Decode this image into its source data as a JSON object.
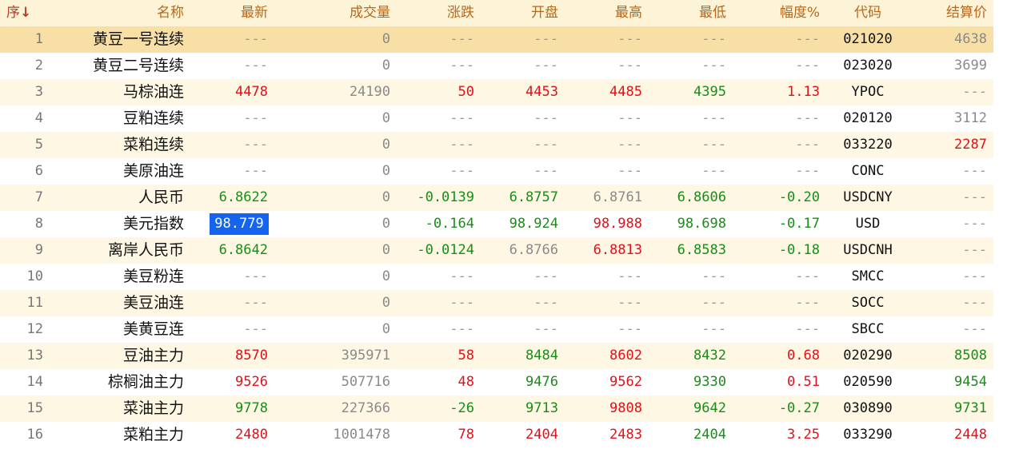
{
  "header": {
    "seq": "序",
    "sort_arrow": "↓",
    "name": "名称",
    "last": "最新",
    "volume": "成交量",
    "change": "涨跌",
    "open": "开盘",
    "high": "最高",
    "low": "最低",
    "pct": "幅度%",
    "code": "代码",
    "settle": "结算价"
  },
  "colors": {
    "up": "#e0121b",
    "down": "#1a8c1a",
    "neutral": "#8a8a8a",
    "header_text": "#b8681b",
    "selected_row": "#f8dfa6",
    "highlight_cell": "#1464f0"
  },
  "rows": [
    {
      "seq": "1",
      "name": "黄豆一号连续",
      "last": "---",
      "volume": "0",
      "change": "---",
      "open": "---",
      "high": "---",
      "low": "---",
      "pct": "---",
      "code": "021020",
      "settle": "4638"
    },
    {
      "seq": "2",
      "name": "黄豆二号连续",
      "last": "---",
      "volume": "0",
      "change": "---",
      "open": "---",
      "high": "---",
      "low": "---",
      "pct": "---",
      "code": "023020",
      "settle": "3699"
    },
    {
      "seq": "3",
      "name": "马棕油连",
      "last": "4478",
      "volume": "24190",
      "change": "50",
      "open": "4453",
      "high": "4485",
      "low": "4395",
      "pct": "1.13",
      "code": "YPOC",
      "settle": "---"
    },
    {
      "seq": "4",
      "name": "豆粕连续",
      "last": "---",
      "volume": "0",
      "change": "---",
      "open": "---",
      "high": "---",
      "low": "---",
      "pct": "---",
      "code": "020120",
      "settle": "3112"
    },
    {
      "seq": "5",
      "name": "菜粕连续",
      "last": "---",
      "volume": "0",
      "change": "---",
      "open": "---",
      "high": "---",
      "low": "---",
      "pct": "---",
      "code": "033220",
      "settle": "2287"
    },
    {
      "seq": "6",
      "name": "美原油连",
      "last": "---",
      "volume": "0",
      "change": "---",
      "open": "---",
      "high": "---",
      "low": "---",
      "pct": "---",
      "code": "CONC",
      "settle": "---"
    },
    {
      "seq": "7",
      "name": "人民币",
      "last": "6.8622",
      "volume": "0",
      "change": "-0.0139",
      "open": "6.8757",
      "high": "6.8761",
      "low": "6.8606",
      "pct": "-0.20",
      "code": "USDCNY",
      "settle": "---"
    },
    {
      "seq": "8",
      "name": "美元指数",
      "last": "98.779",
      "volume": "0",
      "change": "-0.164",
      "open": "98.924",
      "high": "98.988",
      "low": "98.698",
      "pct": "-0.17",
      "code": "USD",
      "settle": "---"
    },
    {
      "seq": "9",
      "name": "离岸人民币",
      "last": "6.8642",
      "volume": "0",
      "change": "-0.0124",
      "open": "6.8766",
      "high": "6.8813",
      "low": "6.8583",
      "pct": "-0.18",
      "code": "USDCNH",
      "settle": "---"
    },
    {
      "seq": "10",
      "name": "美豆粉连",
      "last": "---",
      "volume": "0",
      "change": "---",
      "open": "---",
      "high": "---",
      "low": "---",
      "pct": "---",
      "code": "SMCC",
      "settle": "---"
    },
    {
      "seq": "11",
      "name": "美豆油连",
      "last": "---",
      "volume": "0",
      "change": "---",
      "open": "---",
      "high": "---",
      "low": "---",
      "pct": "---",
      "code": "SOCC",
      "settle": "---"
    },
    {
      "seq": "12",
      "name": "美黄豆连",
      "last": "---",
      "volume": "0",
      "change": "---",
      "open": "---",
      "high": "---",
      "low": "---",
      "pct": "---",
      "code": "SBCC",
      "settle": "---"
    },
    {
      "seq": "13",
      "name": "豆油主力",
      "last": "8570",
      "volume": "395971",
      "change": "58",
      "open": "8484",
      "high": "8602",
      "low": "8432",
      "pct": "0.68",
      "code": "020290",
      "settle": "8508"
    },
    {
      "seq": "14",
      "name": "棕榈油主力",
      "last": "9526",
      "volume": "507716",
      "change": "48",
      "open": "9476",
      "high": "9562",
      "low": "9330",
      "pct": "0.51",
      "code": "020590",
      "settle": "9454"
    },
    {
      "seq": "15",
      "name": "菜油主力",
      "last": "9778",
      "volume": "227366",
      "change": "-26",
      "open": "9713",
      "high": "9808",
      "low": "9642",
      "pct": "-0.27",
      "code": "030890",
      "settle": "9731"
    },
    {
      "seq": "16",
      "name": "菜粕主力",
      "last": "2480",
      "volume": "1001478",
      "change": "78",
      "open": "2404",
      "high": "2483",
      "low": "2404",
      "pct": "3.25",
      "code": "033290",
      "settle": "2448"
    }
  ],
  "row_colors": [
    {
      "last": "dash",
      "volume": "gray",
      "change": "dash",
      "open": "dash",
      "high": "dash",
      "low": "dash",
      "pct": "dash",
      "settle": "gray"
    },
    {
      "last": "dash",
      "volume": "gray",
      "change": "dash",
      "open": "dash",
      "high": "dash",
      "low": "dash",
      "pct": "dash",
      "settle": "gray"
    },
    {
      "last": "red",
      "volume": "gray",
      "change": "red",
      "open": "red",
      "high": "red",
      "low": "green",
      "pct": "red",
      "settle": "dash"
    },
    {
      "last": "dash",
      "volume": "gray",
      "change": "dash",
      "open": "dash",
      "high": "dash",
      "low": "dash",
      "pct": "dash",
      "settle": "gray"
    },
    {
      "last": "dash",
      "volume": "gray",
      "change": "dash",
      "open": "dash",
      "high": "dash",
      "low": "dash",
      "pct": "dash",
      "settle": "red"
    },
    {
      "last": "dash",
      "volume": "gray",
      "change": "dash",
      "open": "dash",
      "high": "dash",
      "low": "dash",
      "pct": "dash",
      "settle": "dash"
    },
    {
      "last": "green",
      "volume": "gray",
      "change": "green",
      "open": "green",
      "high": "gray",
      "low": "green",
      "pct": "green",
      "settle": "dash"
    },
    {
      "last": "highlight",
      "volume": "gray",
      "change": "green",
      "open": "green",
      "high": "red",
      "low": "green",
      "pct": "green",
      "settle": "dash"
    },
    {
      "last": "green",
      "volume": "gray",
      "change": "green",
      "open": "gray",
      "high": "red",
      "low": "green",
      "pct": "green",
      "settle": "dash"
    },
    {
      "last": "dash",
      "volume": "gray",
      "change": "dash",
      "open": "dash",
      "high": "dash",
      "low": "dash",
      "pct": "dash",
      "settle": "dash"
    },
    {
      "last": "dash",
      "volume": "gray",
      "change": "dash",
      "open": "dash",
      "high": "dash",
      "low": "dash",
      "pct": "dash",
      "settle": "dash"
    },
    {
      "last": "dash",
      "volume": "gray",
      "change": "dash",
      "open": "dash",
      "high": "dash",
      "low": "dash",
      "pct": "dash",
      "settle": "dash"
    },
    {
      "last": "red",
      "volume": "gray",
      "change": "red",
      "open": "green",
      "high": "red",
      "low": "green",
      "pct": "red",
      "settle": "green"
    },
    {
      "last": "red",
      "volume": "gray",
      "change": "red",
      "open": "green",
      "high": "red",
      "low": "green",
      "pct": "red",
      "settle": "green"
    },
    {
      "last": "green",
      "volume": "gray",
      "change": "green",
      "open": "green",
      "high": "red",
      "low": "green",
      "pct": "green",
      "settle": "green"
    },
    {
      "last": "red",
      "volume": "gray",
      "change": "red",
      "open": "red",
      "high": "red",
      "low": "green",
      "pct": "red",
      "settle": "red"
    }
  ]
}
